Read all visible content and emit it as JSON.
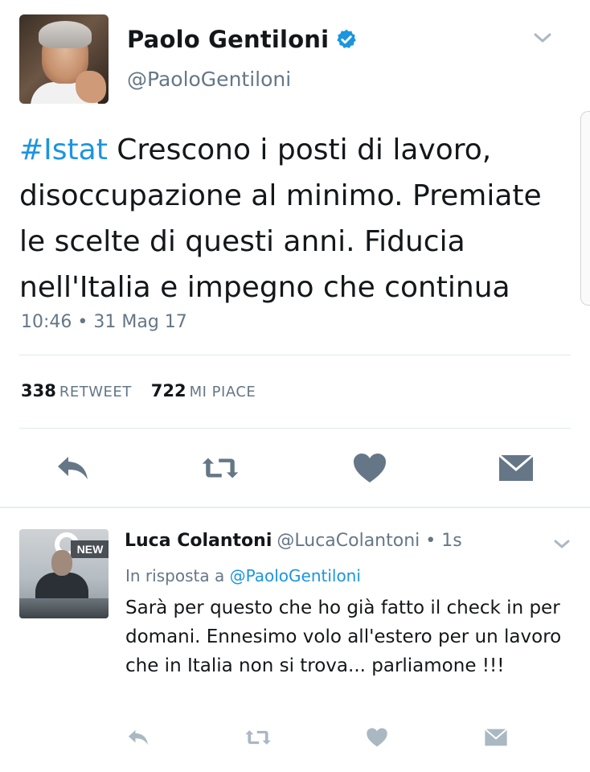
{
  "tweet": {
    "author_name": "Paolo Gentiloni",
    "author_handle": "@PaoloGentiloni",
    "hashtag": "#Istat",
    "text": " Crescono i posti di lavoro, disoccupazione al minimo. Premiate le scelte di questi anni. Fiducia nell'Italia e impegno che continua",
    "timestamp": "10:46 • 31 Mag 17",
    "retweet_count": "338",
    "retweet_label": "RETWEET",
    "like_count": "722",
    "like_label": "MI PIACE"
  },
  "reply": {
    "author_name": "Luca Colantoni",
    "author_handle": "@LucaColantoni",
    "time": " • 1s",
    "in_reply_prefix": "In risposta a ",
    "in_reply_to": "@PaoloGentiloni",
    "text": "Sarà per questo che ho già fatto il check in per domani. Ennesimo volo all'estero per un lavoro che in Italia non si trova... parliamone !!!",
    "avatar_badge": "NEW"
  },
  "icons": {
    "reply": "reply-icon",
    "retweet": "retweet-icon",
    "like": "heart-icon",
    "message": "envelope-icon",
    "menu": "chevron-down-icon",
    "verified": "verified-badge-icon"
  },
  "colors": {
    "accent": "#1b95e0",
    "icon": "#657786",
    "text": "#14171a",
    "muted": "#657786"
  }
}
